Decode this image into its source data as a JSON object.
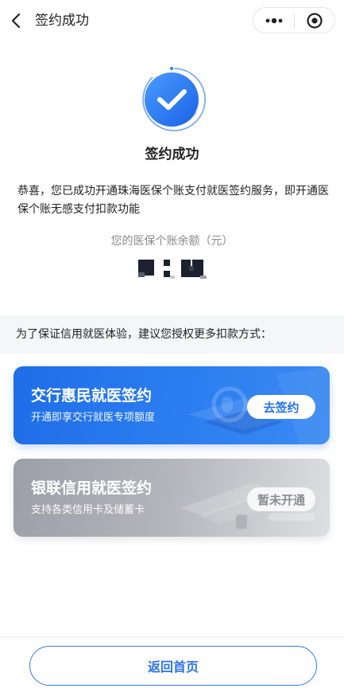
{
  "navbar": {
    "title": "签约成功"
  },
  "status": {
    "title": "签约成功",
    "message": "恭喜，您已成功开通珠海医保个账支付就医签约服务，即开通医保个账无感支付扣款功能",
    "balance_label": "您的医保个账余额（元）"
  },
  "tip": {
    "text": "为了保证信用就医体验，建议您授权更多扣款方式："
  },
  "cards": [
    {
      "title": "交行惠民就医签约",
      "subtitle": "开通即享交行就医专项额度",
      "button": "去签约",
      "enabled": true
    },
    {
      "title": "银联信用就医签约",
      "subtitle": "支持各类信用卡及储蓄卡",
      "button": "暂未开通",
      "enabled": false
    }
  ],
  "footer": {
    "home_button": "返回首页"
  },
  "colors": {
    "primary": "#2a72ea",
    "card_blue": "#2c7ef0",
    "card_gray": "#b3b6bc"
  },
  "icons": [
    "back-icon",
    "more-icon",
    "close-target-icon",
    "success-check-icon"
  ]
}
